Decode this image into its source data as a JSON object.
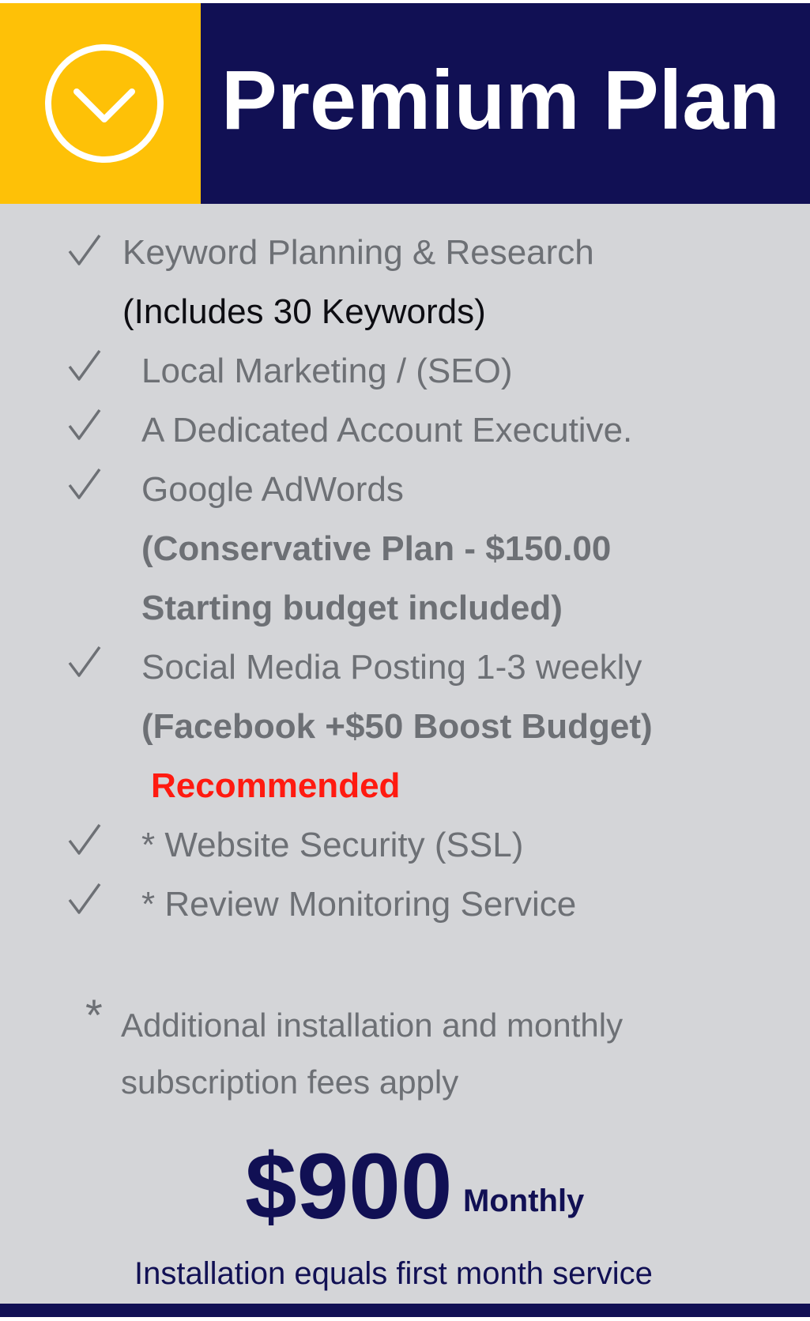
{
  "header": {
    "title": "Premium Plan",
    "icon": "chevron-down-circle-icon",
    "accent_color": "#fec107",
    "brand_color": "#111054"
  },
  "features": [
    {
      "lines": [
        "Keyword Planning &  Research",
        "(Includes 30 Keywords)"
      ]
    },
    {
      "lines": [
        "Local Marketing / (SEO)"
      ]
    },
    {
      "lines": [
        "A Dedicated Account Executive."
      ]
    },
    {
      "lines": [
        "Google AdWords",
        "(Conservative Plan - $150.00",
        "Starting budget included)"
      ]
    },
    {
      "lines": [
        "Social Media Posting 1-3 weekly",
        "(Facebook +$50 Boost Budget)",
        "Recommended"
      ]
    },
    {
      "lines": [
        "* Website Security (SSL)"
      ]
    },
    {
      "lines": [
        "* Review Monitoring Service"
      ]
    }
  ],
  "footnote": {
    "star": "*",
    "line1": "Additional installation and monthly",
    "line2": "subscription fees apply"
  },
  "pricing": {
    "amount": "$900",
    "period": "Monthly",
    "note": "Installation equals first month service"
  },
  "recommended_color": "#ff1a10"
}
